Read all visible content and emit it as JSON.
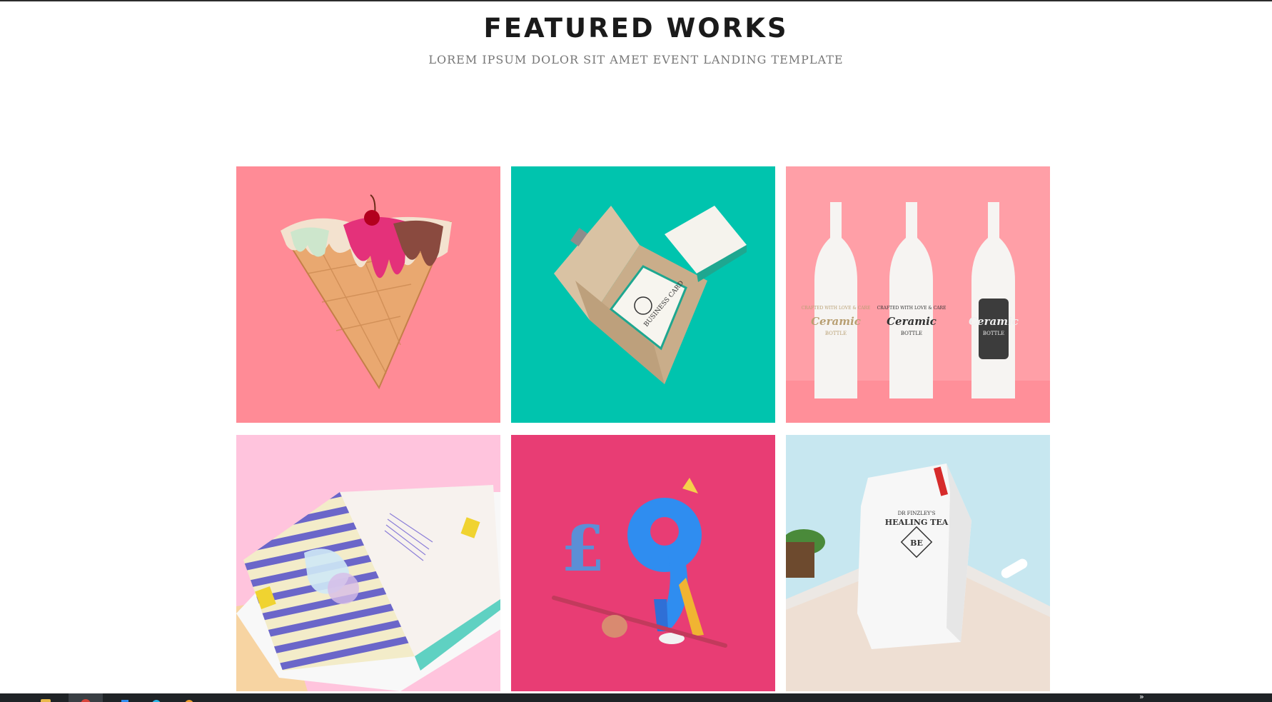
{
  "section": {
    "title": "FEATURED WORKS",
    "subtitle": "LOREM IPSUM DOLOR SIT AMET EVENT LANDING TEMPLATE"
  },
  "works": [
    {
      "name": "ice-cream-cone",
      "bg": "#ff8b96"
    },
    {
      "name": "business-card-box",
      "bg": "#00c4ae",
      "card_text": "BUSINESS CARD"
    },
    {
      "name": "ceramic-bottles",
      "bg": "#ff9fa7",
      "label_small": "CRAFTED WITH LOVE & CARE",
      "label_main": "Ceramic",
      "label_sub": "BOTTLE"
    },
    {
      "name": "striped-book",
      "bg": "#ffc4dd"
    },
    {
      "name": "pound-nine-character",
      "bg": "#e83d74"
    },
    {
      "name": "healing-tea-pouch",
      "bg": "#c7e7f0",
      "brand_small": "DR FINZLEY'S",
      "brand_main": "HEALING TEA",
      "monogram": "BE"
    }
  ],
  "taskbar": {
    "icons": [
      "folder-icon",
      "chrome-icon",
      "app-icon",
      "app-icon",
      "app-icon"
    ],
    "overflow": "»"
  },
  "colors": {
    "title": "#1a1a1a",
    "subtitle": "#777777",
    "taskbar": "#1f2326"
  }
}
